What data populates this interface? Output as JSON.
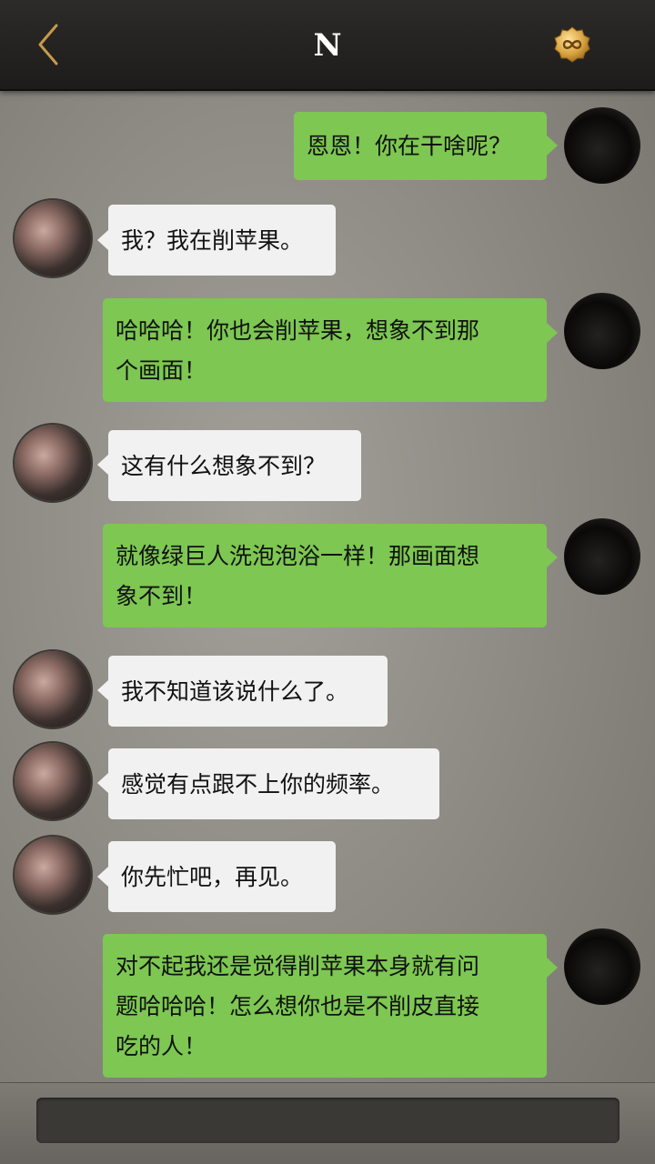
{
  "header": {
    "title": "N",
    "back_icon": "chevron-left-icon",
    "right_icon": "infinity-badge-icon",
    "accent": "#c79a4a"
  },
  "colors": {
    "outgoing_bubble": "#7dc752",
    "incoming_bubble": "#f1f1f1"
  },
  "messages": [
    {
      "side": "out",
      "lines": [
        "恩恩！你在干啥呢？"
      ]
    },
    {
      "side": "in",
      "lines": [
        "我？我在削苹果。"
      ]
    },
    {
      "side": "out",
      "lines": [
        "哈哈哈！你也会削苹果，想象不到那",
        "个画面！"
      ]
    },
    {
      "side": "in",
      "lines": [
        "这有什么想象不到？"
      ]
    },
    {
      "side": "out",
      "lines": [
        "就像绿巨人洗泡泡浴一样！那画面想",
        "象不到！"
      ]
    },
    {
      "side": "in",
      "lines": [
        "我不知道该说什么了。"
      ]
    },
    {
      "side": "in",
      "lines": [
        "感觉有点跟不上你的频率。"
      ]
    },
    {
      "side": "in",
      "lines": [
        "你先忙吧，再见。"
      ]
    },
    {
      "side": "out",
      "lines": [
        "对不起我还是觉得削苹果本身就有问",
        "题哈哈哈！怎么想你也是不削皮直接",
        "吃的人！"
      ]
    }
  ],
  "input": {
    "placeholder": ""
  }
}
